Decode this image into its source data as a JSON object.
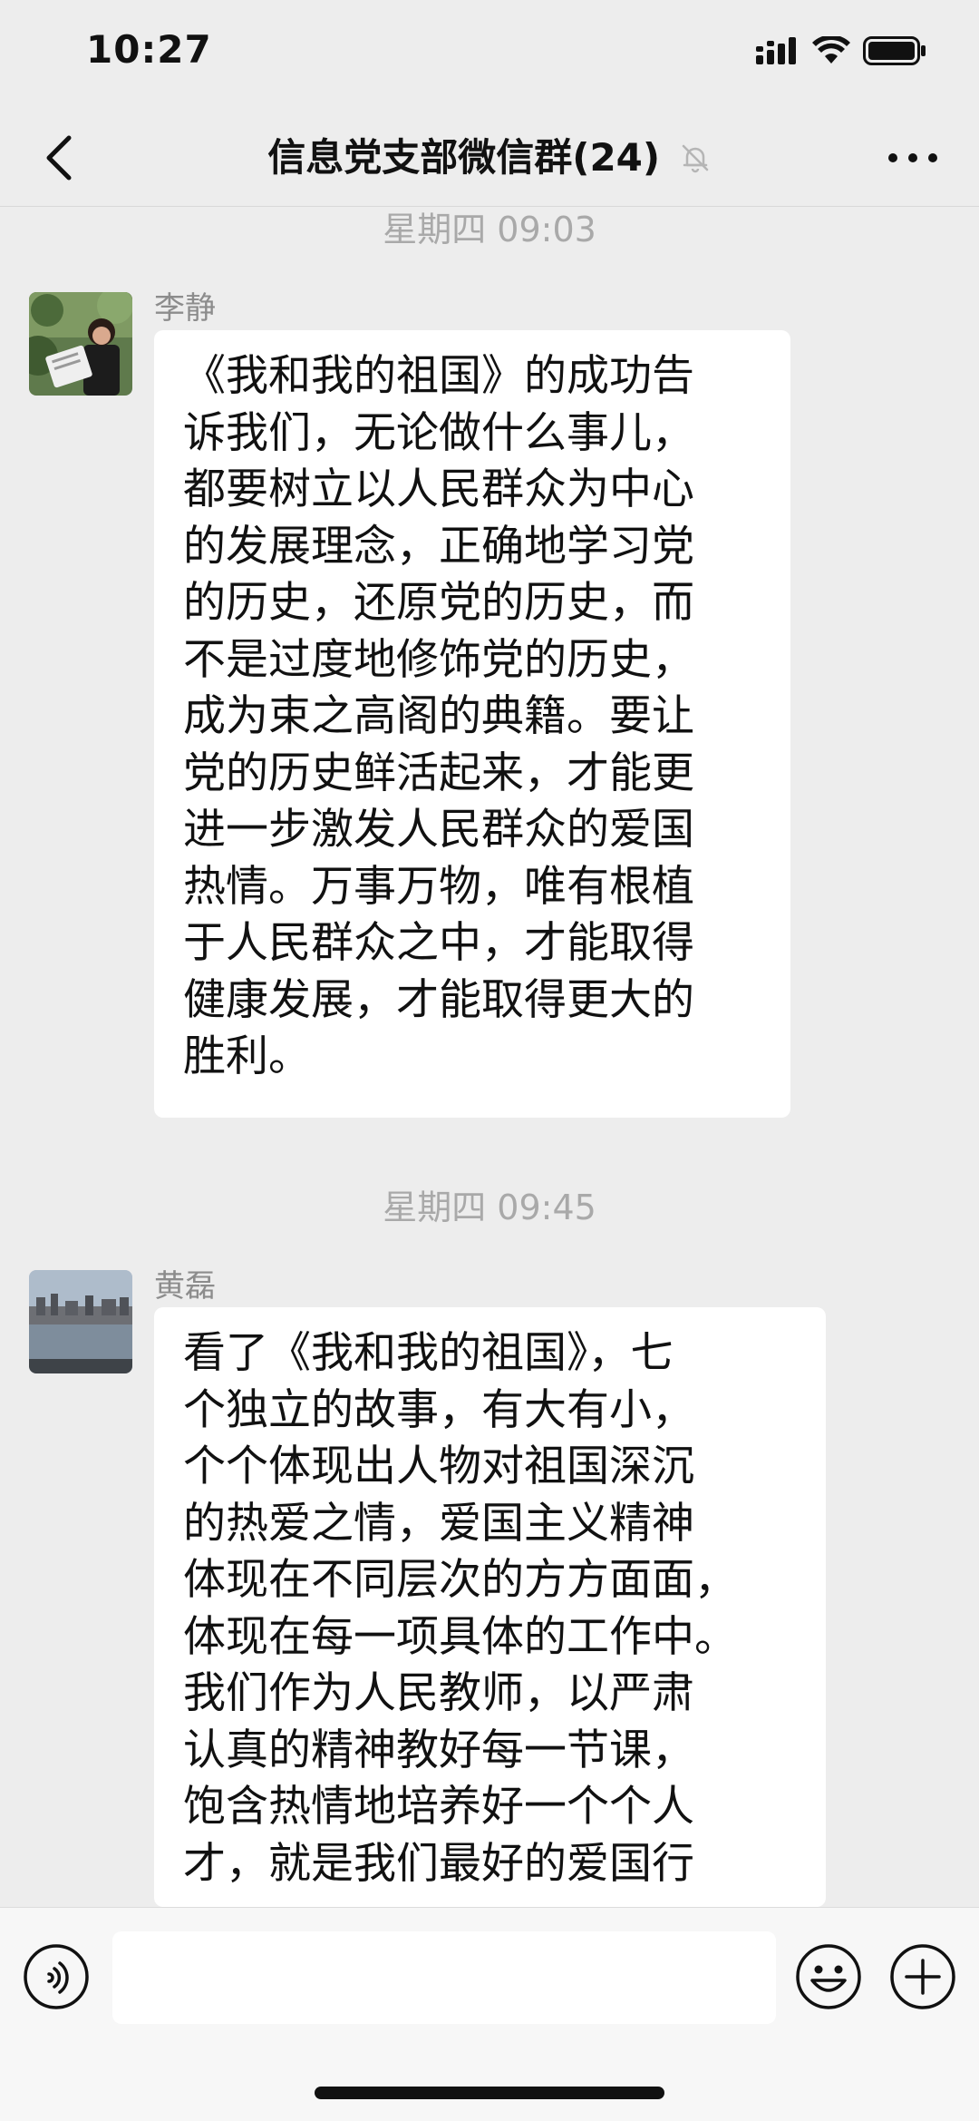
{
  "status_bar": {
    "time": "10:27"
  },
  "nav": {
    "title": "信息党支部微信群(24)",
    "back_icon": "chevron-left-icon",
    "mute_icon": "bell-muted-icon",
    "more_icon": "more-dots-icon"
  },
  "messages": [
    {
      "timestamp": "星期四 09:03",
      "sender": "李静",
      "text": "《我和我的祖国》的成功告\n诉我们，无论做什么事儿，\n都要树立以人民群众为中心\n的发展理念，正确地学习党\n的历史，还原党的历史，而\n不是过度地修饰党的历史，\n成为束之高阁的典籍。要让\n党的历史鲜活起来，才能更\n进一步激发人民群众的爱国\n热情。万事万物，唯有根植\n于人民群众之中，才能取得\n健康发展，才能取得更大的\n胜利。"
    },
    {
      "timestamp": "星期四 09:45",
      "sender": "黄磊",
      "text": "看了《我和我的祖国》，七\n个独立的故事，有大有小，\n个个体现出人物对祖国深沉\n的热爱之情，爱国主义精神\n体现在不同层次的方方面面，\n体现在每一项具体的工作中。\n我们作为人民教师，以严肃\n认真的精神教好每一节课，\n饱含热情地培养好一个个人\n才，就是我们最好的爱国行"
    }
  ],
  "input_bar": {
    "voice_icon": "voice-icon",
    "emoji_icon": "emoji-icon",
    "plus_icon": "plus-icon",
    "text_value": ""
  }
}
